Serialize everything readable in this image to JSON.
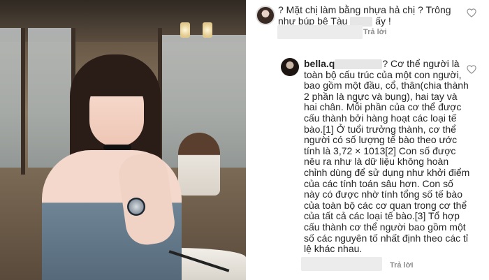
{
  "comments": [
    {
      "text_after_avatar": "? Mặt chị làm bằng nhựa hả chị ? Trông như búp bê Tàu",
      "text_tail": "ấy !",
      "reply_label": "Trả lời"
    },
    {
      "username": "bella.q",
      "body": "? Cơ thể người là toàn bộ cấu trúc của một con người, bao gồm một đầu, cổ, thân(chia thành 2 phần là ngực và bụng), hai tay và hai chân. Mỗi phần của cơ thể được cấu thành bởi hàng hoạt các loại tế bào.[1] Ở tuổi trưởng thành, cơ thể người có số lượng tế bào theo ước tính là 3,72 × 1013[2] Con số được nêu ra như là dữ liệu không hoàn chỉnh dùng để sử dụng như khởi điểm của các tính toán sâu hơn. Con số này có được nhờ tính tổng số tế bào của toàn bộ các cơ quan trong cơ thể của tất cả các loại tế bào.[3] Tổ hợp cấu thành cơ thể người bao gồm một số các nguyên tố nhất định theo các tỉ lệ khác nhau.",
      "reply_label": "Trả lời"
    }
  ],
  "icons": {
    "heart": "heart-outline-icon"
  },
  "colors": {
    "text": "#262626",
    "meta": "#8e8e8e"
  }
}
